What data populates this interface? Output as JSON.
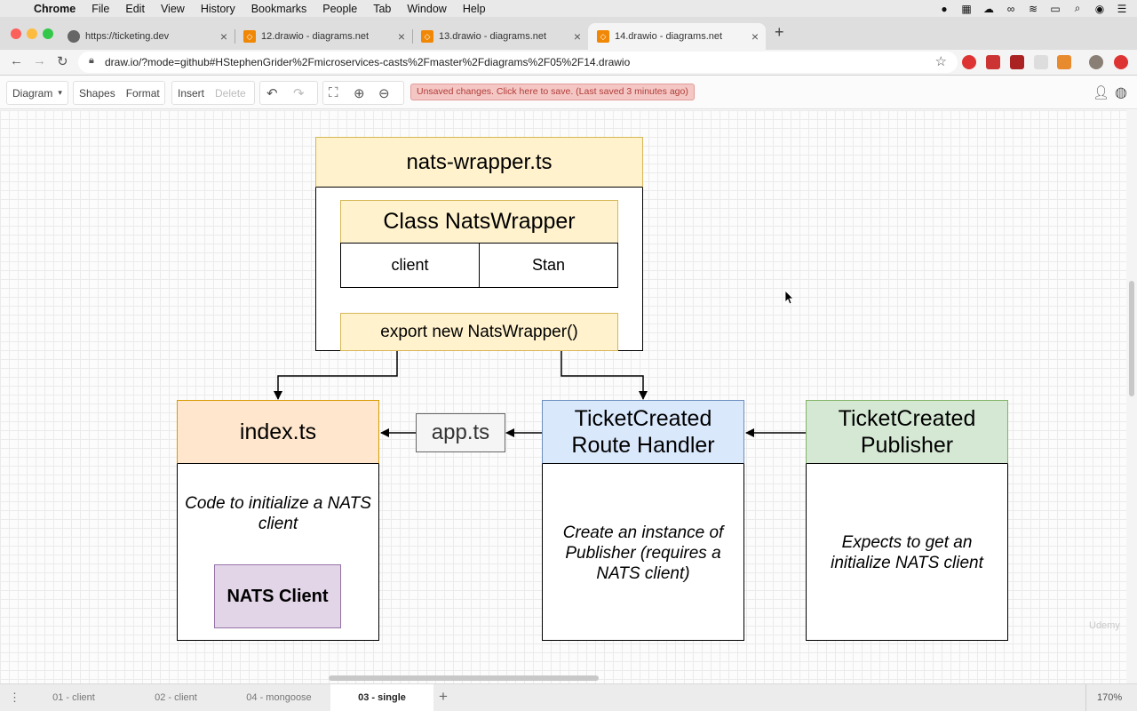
{
  "menubar": {
    "app": "Chrome",
    "items": [
      "File",
      "Edit",
      "View",
      "History",
      "Bookmarks",
      "People",
      "Tab",
      "Window",
      "Help"
    ]
  },
  "tabs": [
    {
      "title": "https://ticketing.dev"
    },
    {
      "title": "12.drawio - diagrams.net"
    },
    {
      "title": "13.drawio - diagrams.net"
    },
    {
      "title": "14.drawio - diagrams.net"
    }
  ],
  "address": {
    "url": "draw.io/?mode=github#HStephenGrider%2Fmicroservices-casts%2Fmaster%2Fdiagrams%2F05%2F14.drawio"
  },
  "drawio_toolbar": {
    "diagram": "Diagram",
    "shapes": "Shapes",
    "format": "Format",
    "insert": "Insert",
    "delete": "Delete",
    "unsaved": "Unsaved changes. Click here to save. (Last saved 3 minutes ago)"
  },
  "diagram": {
    "wrapper_title": "nats-wrapper.ts",
    "class_title": "Class NatsWrapper",
    "field_client": "client",
    "field_stan": "Stan",
    "export": "export new NatsWrapper()",
    "index_title": "index.ts",
    "index_desc": "Code to initialize a NATS client",
    "nats_client": "NATS Client",
    "app_label": "app.ts",
    "handler_title": "TicketCreated Route Handler",
    "handler_desc": "Create an instance of Publisher (requires a NATS client)",
    "publisher_title": "TicketCreated Publisher",
    "publisher_desc": "Expects to get an initialize NATS client"
  },
  "watermark": "Udemy",
  "pages": {
    "tabs": [
      "01 - client",
      "02 - client",
      "04 - mongoose",
      "03 - single"
    ],
    "zoom": "170%"
  },
  "colors": {
    "yellow_fill": "#fff2cc",
    "yellow_stroke": "#d6b656",
    "orange_fill": "#ffe6cc",
    "orange_stroke": "#d79b00",
    "blue_fill": "#dae8fc",
    "blue_stroke": "#6c8ebf",
    "green_fill": "#d5e8d4",
    "green_stroke": "#82b366",
    "purple_fill": "#e1d5e7",
    "purple_stroke": "#9673a6",
    "unsaved_bg": "#f4c7c5"
  }
}
